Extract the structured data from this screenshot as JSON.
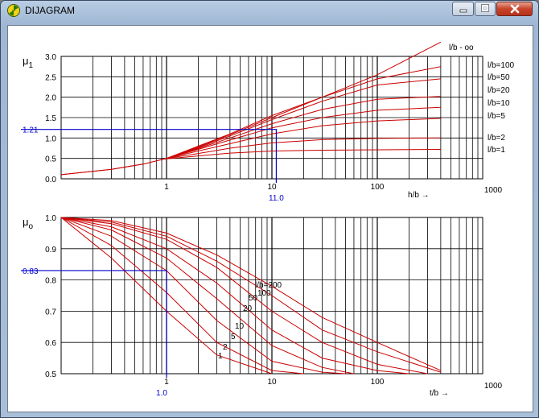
{
  "window": {
    "title": "DIJAGRAM",
    "minimize_icon": "minimize-icon",
    "maximize_icon": "maximize-icon",
    "close_icon": "close-icon",
    "app_icon": "radiation-icon"
  },
  "colors": {
    "curve": "#cc0000",
    "readout": "#0000cc",
    "grid": "#000000",
    "background": "#ffffff"
  },
  "chart_data": [
    {
      "type": "line",
      "name": "mu1",
      "title": "",
      "ylabel": "μ1",
      "ylabel_main": "μ",
      "ylabel_sub": "1",
      "xlabel": "h/b →",
      "x_scale": "log",
      "xlim": [
        0.1,
        1000
      ],
      "ylim": [
        0,
        3
      ],
      "x_ticks": [
        "1",
        "10",
        "100",
        "1000"
      ],
      "y_ticks": [
        "0.0",
        "0.5",
        "1.0",
        "1.5",
        "2.0",
        "2.5",
        "3.0"
      ],
      "grid": true,
      "readout": {
        "x": 11.0,
        "y": 1.21,
        "x_label": "11.0",
        "y_label": "1.21"
      },
      "curve_labels": [
        "l/b - oo",
        "l/b=100",
        "l/b=50",
        "l/b=20",
        "l/b=10",
        "l/b=5",
        "l/b=2",
        "l/b=1"
      ],
      "series": [
        {
          "label_index": 0,
          "points": [
            [
              0.1,
              0.1
            ],
            [
              0.3,
              0.23
            ],
            [
              0.6,
              0.36
            ],
            [
              1,
              0.5
            ],
            [
              2,
              0.8
            ],
            [
              4,
              1.1
            ],
            [
              10,
              1.55
            ],
            [
              30,
              2.0
            ],
            [
              100,
              2.55
            ],
            [
              400,
              3.35
            ]
          ]
        },
        {
          "label_index": 1,
          "points": [
            [
              0.1,
              0.1
            ],
            [
              0.3,
              0.23
            ],
            [
              0.6,
              0.36
            ],
            [
              1,
              0.5
            ],
            [
              2,
              0.78
            ],
            [
              4,
              1.08
            ],
            [
              10,
              1.5
            ],
            [
              30,
              2.0
            ],
            [
              100,
              2.45
            ],
            [
              400,
              2.75
            ]
          ]
        },
        {
          "label_index": 2,
          "points": [
            [
              1,
              0.5
            ],
            [
              2,
              0.76
            ],
            [
              4,
              1.05
            ],
            [
              10,
              1.45
            ],
            [
              30,
              1.9
            ],
            [
              100,
              2.3
            ],
            [
              400,
              2.45
            ]
          ]
        },
        {
          "label_index": 3,
          "points": [
            [
              1,
              0.5
            ],
            [
              2,
              0.74
            ],
            [
              4,
              1.0
            ],
            [
              10,
              1.35
            ],
            [
              30,
              1.7
            ],
            [
              100,
              1.95
            ],
            [
              400,
              2.02
            ]
          ]
        },
        {
          "label_index": 4,
          "points": [
            [
              1,
              0.5
            ],
            [
              2,
              0.72
            ],
            [
              4,
              0.95
            ],
            [
              10,
              1.25
            ],
            [
              30,
              1.5
            ],
            [
              100,
              1.68
            ],
            [
              400,
              1.75
            ]
          ]
        },
        {
          "label_index": 5,
          "points": [
            [
              1,
              0.5
            ],
            [
              2,
              0.68
            ],
            [
              4,
              0.86
            ],
            [
              10,
              1.1
            ],
            [
              30,
              1.3
            ],
            [
              100,
              1.42
            ],
            [
              400,
              1.48
            ]
          ]
        },
        {
          "label_index": 6,
          "points": [
            [
              1,
              0.5
            ],
            [
              2,
              0.62
            ],
            [
              4,
              0.75
            ],
            [
              10,
              0.88
            ],
            [
              30,
              0.96
            ],
            [
              100,
              0.99
            ],
            [
              400,
              1.0
            ]
          ]
        },
        {
          "label_index": 7,
          "points": [
            [
              0.9,
              0.48
            ],
            [
              2,
              0.56
            ],
            [
              4,
              0.63
            ],
            [
              10,
              0.68
            ],
            [
              30,
              0.7
            ],
            [
              100,
              0.71
            ],
            [
              400,
              0.72
            ]
          ]
        }
      ]
    },
    {
      "type": "line",
      "name": "mu0",
      "title": "",
      "ylabel": "μo",
      "ylabel_main": "μ",
      "ylabel_sub": "o",
      "xlabel": "t/b →",
      "x_scale": "log",
      "xlim": [
        0.1,
        1000
      ],
      "ylim": [
        0.5,
        1.0
      ],
      "x_ticks": [
        "1",
        "10",
        "100",
        "1000"
      ],
      "y_ticks": [
        "0.5",
        "0.6",
        "0.7",
        "0.8",
        "0.9",
        "1.0"
      ],
      "grid": true,
      "readout": {
        "x": 1.0,
        "y": 0.83,
        "x_label": "1.0",
        "y_label": "0.83"
      },
      "curve_labels": [
        "l/b=200",
        "100",
        "50",
        "20",
        "10",
        "5",
        "2",
        "1"
      ],
      "series": [
        {
          "label_index": 0,
          "points": [
            [
              0.1,
              1.0
            ],
            [
              0.3,
              0.99
            ],
            [
              1,
              0.95
            ],
            [
              3,
              0.88
            ],
            [
              10,
              0.78
            ],
            [
              30,
              0.68
            ],
            [
              100,
              0.6
            ],
            [
              400,
              0.51
            ]
          ]
        },
        {
          "label_index": 1,
          "points": [
            [
              0.1,
              1.0
            ],
            [
              0.3,
              0.985
            ],
            [
              1,
              0.94
            ],
            [
              3,
              0.86
            ],
            [
              10,
              0.75
            ],
            [
              30,
              0.64
            ],
            [
              100,
              0.57
            ],
            [
              400,
              0.505
            ]
          ]
        },
        {
          "label_index": 2,
          "points": [
            [
              0.1,
              1.0
            ],
            [
              0.3,
              0.98
            ],
            [
              1,
              0.93
            ],
            [
              3,
              0.84
            ],
            [
              10,
              0.7
            ],
            [
              30,
              0.6
            ],
            [
              100,
              0.53
            ],
            [
              300,
              0.5
            ]
          ]
        },
        {
          "label_index": 3,
          "points": [
            [
              0.1,
              1.0
            ],
            [
              0.3,
              0.97
            ],
            [
              1,
              0.9
            ],
            [
              3,
              0.79
            ],
            [
              10,
              0.64
            ],
            [
              30,
              0.55
            ],
            [
              100,
              0.51
            ],
            [
              200,
              0.5
            ]
          ]
        },
        {
          "label_index": 4,
          "points": [
            [
              0.1,
              1.0
            ],
            [
              0.3,
              0.96
            ],
            [
              1,
              0.87
            ],
            [
              3,
              0.74
            ],
            [
              10,
              0.59
            ],
            [
              30,
              0.52
            ],
            [
              60,
              0.5
            ]
          ]
        },
        {
          "label_index": 5,
          "points": [
            [
              0.1,
              1.0
            ],
            [
              0.3,
              0.94
            ],
            [
              1,
              0.83
            ],
            [
              3,
              0.67
            ],
            [
              10,
              0.54
            ],
            [
              30,
              0.505
            ],
            [
              50,
              0.5
            ]
          ]
        },
        {
          "label_index": 6,
          "points": [
            [
              0.1,
              1.0
            ],
            [
              0.3,
              0.91
            ],
            [
              1,
              0.76
            ],
            [
              3,
              0.6
            ],
            [
              10,
              0.51
            ],
            [
              20,
              0.5
            ]
          ]
        },
        {
          "label_index": 7,
          "points": [
            [
              0.1,
              1.0
            ],
            [
              0.3,
              0.87
            ],
            [
              1,
              0.7
            ],
            [
              3,
              0.56
            ],
            [
              10,
              0.5
            ]
          ]
        }
      ]
    }
  ]
}
